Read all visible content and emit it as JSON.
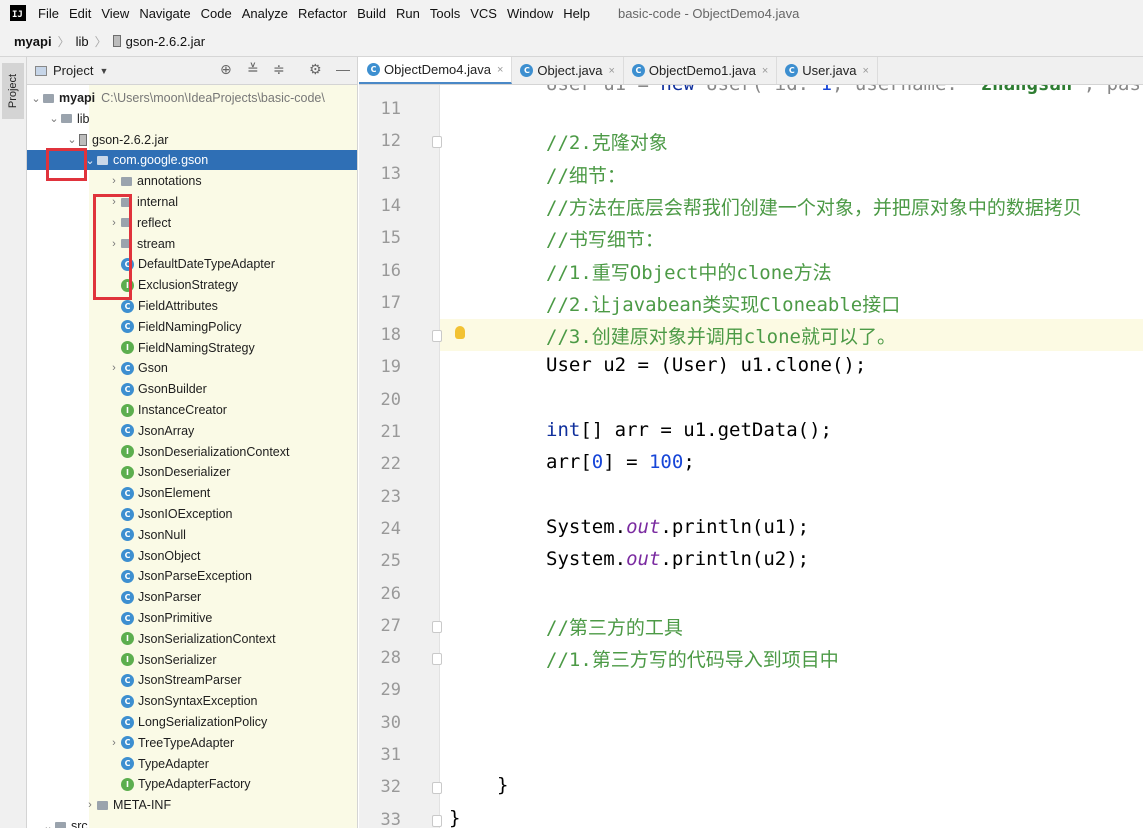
{
  "app": {
    "menu": [
      "File",
      "Edit",
      "View",
      "Navigate",
      "Code",
      "Analyze",
      "Refactor",
      "Build",
      "Run",
      "Tools",
      "VCS",
      "Window",
      "Help"
    ],
    "window_title": "basic-code - ObjectDemo4.java"
  },
  "breadcrumb": [
    "myapi",
    "lib",
    "gson-2.6.2.jar"
  ],
  "sidebar": {
    "strip_label": "Project",
    "header": "Project"
  },
  "tree": {
    "root_name": "myapi",
    "root_path": "C:\\Users\\moon\\IdeaProjects\\basic-code\\",
    "lib": "lib",
    "jar": "gson-2.6.2.jar",
    "package": "com.google.gson",
    "subpackages": [
      "annotations",
      "internal",
      "reflect",
      "stream"
    ],
    "classes": [
      {
        "name": "DefaultDateTypeAdapter",
        "kind": "c",
        "expandable": false
      },
      {
        "name": "ExclusionStrategy",
        "kind": "i",
        "expandable": false
      },
      {
        "name": "FieldAttributes",
        "kind": "c",
        "expandable": false
      },
      {
        "name": "FieldNamingPolicy",
        "kind": "c",
        "expandable": false
      },
      {
        "name": "FieldNamingStrategy",
        "kind": "i",
        "expandable": false
      },
      {
        "name": "Gson",
        "kind": "c",
        "expandable": true
      },
      {
        "name": "GsonBuilder",
        "kind": "c",
        "expandable": false
      },
      {
        "name": "InstanceCreator",
        "kind": "i",
        "expandable": false
      },
      {
        "name": "JsonArray",
        "kind": "c",
        "expandable": false
      },
      {
        "name": "JsonDeserializationContext",
        "kind": "i",
        "expandable": false
      },
      {
        "name": "JsonDeserializer",
        "kind": "i",
        "expandable": false
      },
      {
        "name": "JsonElement",
        "kind": "c",
        "expandable": false
      },
      {
        "name": "JsonIOException",
        "kind": "c",
        "expandable": false
      },
      {
        "name": "JsonNull",
        "kind": "c",
        "expandable": false
      },
      {
        "name": "JsonObject",
        "kind": "c",
        "expandable": false
      },
      {
        "name": "JsonParseException",
        "kind": "c",
        "expandable": false
      },
      {
        "name": "JsonParser",
        "kind": "c",
        "expandable": false
      },
      {
        "name": "JsonPrimitive",
        "kind": "c",
        "expandable": false
      },
      {
        "name": "JsonSerializationContext",
        "kind": "i",
        "expandable": false
      },
      {
        "name": "JsonSerializer",
        "kind": "i",
        "expandable": false
      },
      {
        "name": "JsonStreamParser",
        "kind": "c",
        "expandable": false
      },
      {
        "name": "JsonSyntaxException",
        "kind": "c",
        "expandable": false
      },
      {
        "name": "LongSerializationPolicy",
        "kind": "c",
        "expandable": false
      },
      {
        "name": "TreeTypeAdapter",
        "kind": "c",
        "expandable": true
      },
      {
        "name": "TypeAdapter",
        "kind": "c",
        "expandable": false
      },
      {
        "name": "TypeAdapterFactory",
        "kind": "i",
        "expandable": false
      }
    ],
    "meta_inf": "META-INF",
    "src": "src"
  },
  "tabs": [
    {
      "label": "ObjectDemo4.java",
      "active": true
    },
    {
      "label": "Object.java",
      "active": false
    },
    {
      "label": "ObjectDemo1.java",
      "active": false
    },
    {
      "label": "User.java",
      "active": false
    }
  ],
  "editor": {
    "top_partial": "User u1 = new User( id: 1, username: \"zhangsan\", pas",
    "current_line": 18,
    "line_numbers": [
      "11",
      "12",
      "13",
      "14",
      "15",
      "16",
      "17",
      "18",
      "19",
      "20",
      "21",
      "22",
      "23",
      "24",
      "25",
      "26",
      "27",
      "28",
      "29",
      "30",
      "31",
      "32",
      "33"
    ],
    "lines": [
      {
        "n": "11",
        "text": ""
      },
      {
        "n": "12",
        "text": "//2.克隆对象",
        "comment": true
      },
      {
        "n": "13",
        "text": "//细节：",
        "comment": true
      },
      {
        "n": "14",
        "text": "//方法在底层会帮我们创建一个对象，并把原对象中的数据拷贝",
        "comment": true
      },
      {
        "n": "15",
        "text": "//书写细节：",
        "comment": true
      },
      {
        "n": "16",
        "text": "//1.重写Object中的clone方法",
        "comment": true
      },
      {
        "n": "17",
        "text": "//2.让javabean类实现Cloneable接口",
        "comment": true
      },
      {
        "n": "18",
        "text": "//3.创建原对象并调用clone就可以了。",
        "comment": true
      },
      {
        "n": "19",
        "text": "User u2 = (User) u1.clone();"
      },
      {
        "n": "20",
        "text": ""
      },
      {
        "n": "21",
        "text": "int[] arr = u1.getData();"
      },
      {
        "n": "22",
        "text": "arr[0] = 100;"
      },
      {
        "n": "23",
        "text": ""
      },
      {
        "n": "24",
        "text": "System.out.println(u1);"
      },
      {
        "n": "25",
        "text": "System.out.println(u2);"
      },
      {
        "n": "26",
        "text": ""
      },
      {
        "n": "27",
        "text": "//第三方的工具",
        "comment": true
      },
      {
        "n": "28",
        "text": "//1.第三方写的代码导入到项目中",
        "comment": true
      },
      {
        "n": "29",
        "text": ""
      },
      {
        "n": "30",
        "text": ""
      },
      {
        "n": "31",
        "text": ""
      },
      {
        "n": "32",
        "text": "}"
      },
      {
        "n": "33",
        "text": "}"
      }
    ]
  },
  "colors": {
    "selection": "#2f6fb5",
    "highlight_box": "#e0333c",
    "comment": "#4c9a46",
    "keyword": "#0f2f9c",
    "current_line": "#fcfae3"
  }
}
